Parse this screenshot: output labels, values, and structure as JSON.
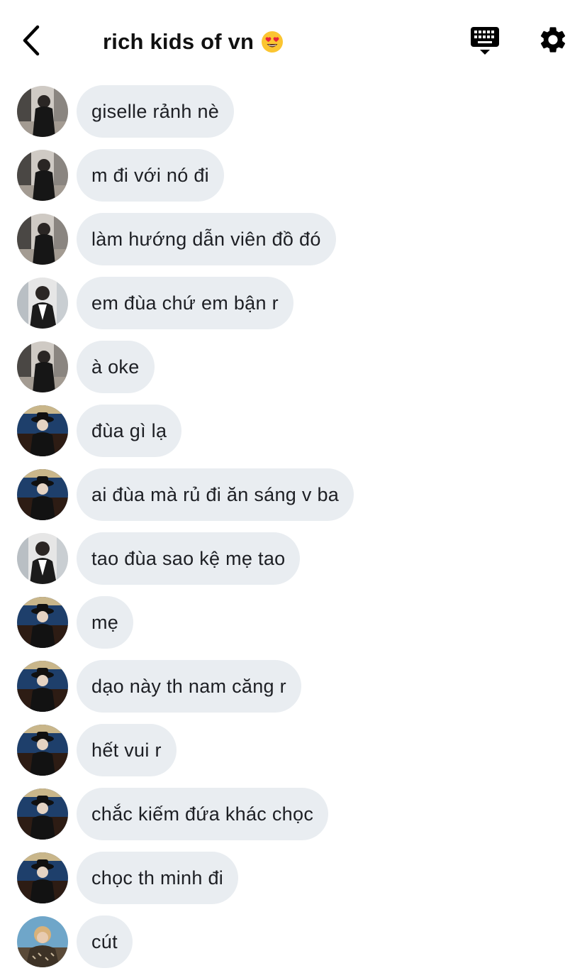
{
  "header": {
    "title": "rich kids of vn",
    "title_emoji": "heart-eyes-emoji",
    "back_icon": "chevron-left-icon",
    "keyboard_icon": "keyboard-icon",
    "settings_icon": "gear-icon"
  },
  "colors": {
    "bubble": "#e9edf1",
    "text": "#1d1f24",
    "icon": "#000000"
  },
  "messages": [
    {
      "avatar": "avatar-a",
      "text": "giselle rảnh nè"
    },
    {
      "avatar": "avatar-a",
      "text": "m đi với nó đi"
    },
    {
      "avatar": "avatar-a",
      "text": "làm hướng dẫn viên đồ đó"
    },
    {
      "avatar": "avatar-b",
      "text": "em đùa chứ em bận r"
    },
    {
      "avatar": "avatar-a",
      "text": "à oke"
    },
    {
      "avatar": "avatar-c",
      "text": "đùa gì lạ"
    },
    {
      "avatar": "avatar-c",
      "text": "ai đùa mà rủ đi ăn sáng v ba"
    },
    {
      "avatar": "avatar-b",
      "text": "tao đùa sao kệ mẹ tao"
    },
    {
      "avatar": "avatar-c",
      "text": "mẹ"
    },
    {
      "avatar": "avatar-c",
      "text": "dạo này th nam căng r"
    },
    {
      "avatar": "avatar-c",
      "text": "hết vui r"
    },
    {
      "avatar": "avatar-c",
      "text": "chắc kiếm đứa khác chọc"
    },
    {
      "avatar": "avatar-c",
      "text": "chọc th minh đi"
    },
    {
      "avatar": "avatar-d",
      "text": "cút"
    }
  ]
}
